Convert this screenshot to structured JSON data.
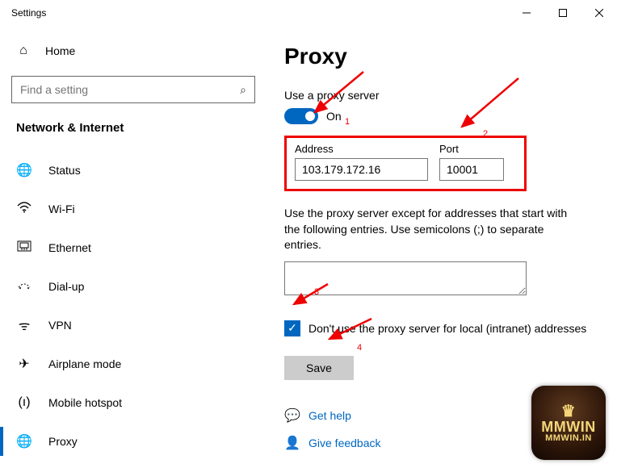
{
  "window": {
    "title": "Settings"
  },
  "sidebar": {
    "home_label": "Home",
    "search_placeholder": "Find a setting",
    "section_header": "Network & Internet",
    "items": [
      {
        "label": "Status"
      },
      {
        "label": "Wi-Fi"
      },
      {
        "label": "Ethernet"
      },
      {
        "label": "Dial-up"
      },
      {
        "label": "VPN"
      },
      {
        "label": "Airplane mode"
      },
      {
        "label": "Mobile hotspot"
      },
      {
        "label": "Proxy"
      }
    ]
  },
  "main": {
    "heading": "Proxy",
    "use_proxy_label": "Use a proxy server",
    "toggle_state": "On",
    "address_label": "Address",
    "address_value": "103.179.172.16",
    "port_label": "Port",
    "port_value": "10001",
    "except_text": "Use the proxy server except for addresses that start with the following entries. Use semicolons (;) to separate entries.",
    "except_value": "",
    "local_checkbox_label": "Don't use the proxy server for local (intranet) addresses",
    "local_checkbox_checked": true,
    "save_label": "Save",
    "help_label": "Get help",
    "feedback_label": "Give feedback"
  },
  "annotations": {
    "n1": "1",
    "n2": "2",
    "n3": "3",
    "n4": "4"
  },
  "logo": {
    "line1": "MMWIN",
    "line2": "MMWIN.IN"
  }
}
